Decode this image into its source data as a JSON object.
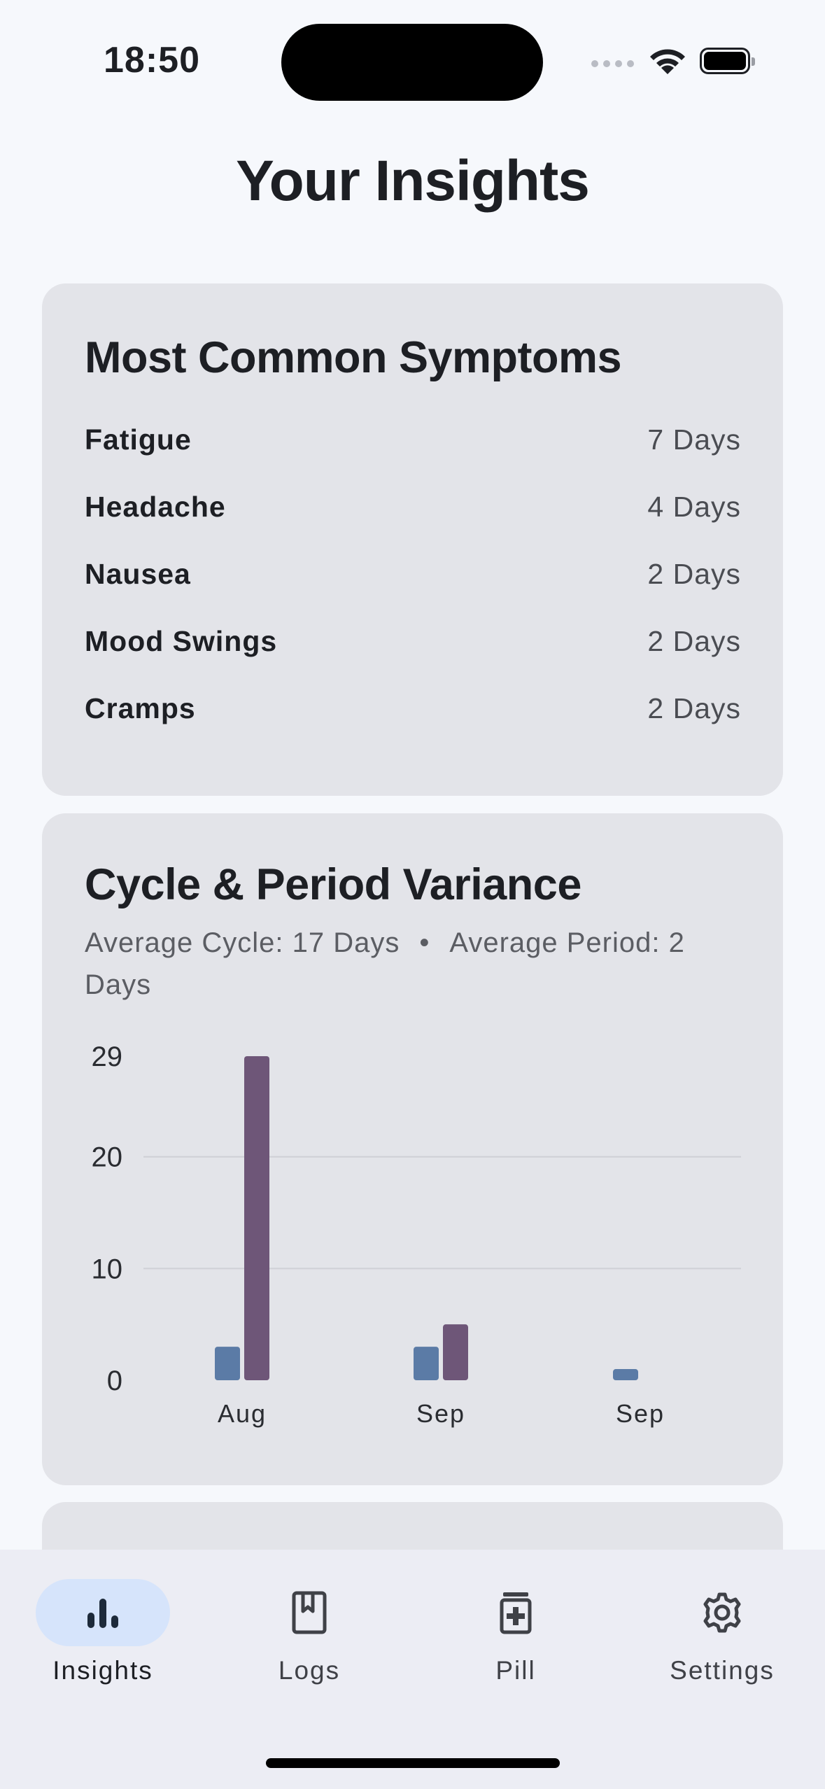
{
  "status_bar": {
    "time": "18:50"
  },
  "page": {
    "title": "Your Insights"
  },
  "symptoms_card": {
    "title": "Most Common Symptoms",
    "items": [
      {
        "name": "Fatigue",
        "days": "7 Days"
      },
      {
        "name": "Headache",
        "days": "4 Days"
      },
      {
        "name": "Nausea",
        "days": "2 Days"
      },
      {
        "name": "Mood Swings",
        "days": "2 Days"
      },
      {
        "name": "Cramps",
        "days": "2 Days"
      }
    ]
  },
  "variance_card": {
    "title": "Cycle & Period Variance",
    "avg_cycle": "Average Cycle: 17 Days",
    "separator": "•",
    "avg_period": "Average Period: 2 Days"
  },
  "chart_data": {
    "type": "bar",
    "categories": [
      "Aug",
      "Sep",
      "Sep"
    ],
    "y_ticks": [
      0,
      10,
      20,
      29
    ],
    "ylim": [
      0,
      29
    ],
    "grid": true,
    "series": [
      {
        "values": [
          3,
          3,
          1
        ],
        "color": "#5b7ba6"
      },
      {
        "values": [
          29,
          5,
          null
        ],
        "color": "#6e5678"
      }
    ]
  },
  "bottom_nav": {
    "items": [
      {
        "label": "Insights",
        "icon": "bar-chart-icon",
        "active": true
      },
      {
        "label": "Logs",
        "icon": "bookmark-book-icon",
        "active": false
      },
      {
        "label": "Pill",
        "icon": "pill-bottle-icon",
        "active": false
      },
      {
        "label": "Settings",
        "icon": "gear-icon",
        "active": false
      }
    ]
  },
  "colors": {
    "background": "#f6f8fc",
    "card": "#e3e4e9",
    "nav_background": "#ecedf4",
    "active_pill": "#d6e4fb",
    "cycle_bar": "#5b7ba6",
    "period_bar": "#6e5678"
  }
}
